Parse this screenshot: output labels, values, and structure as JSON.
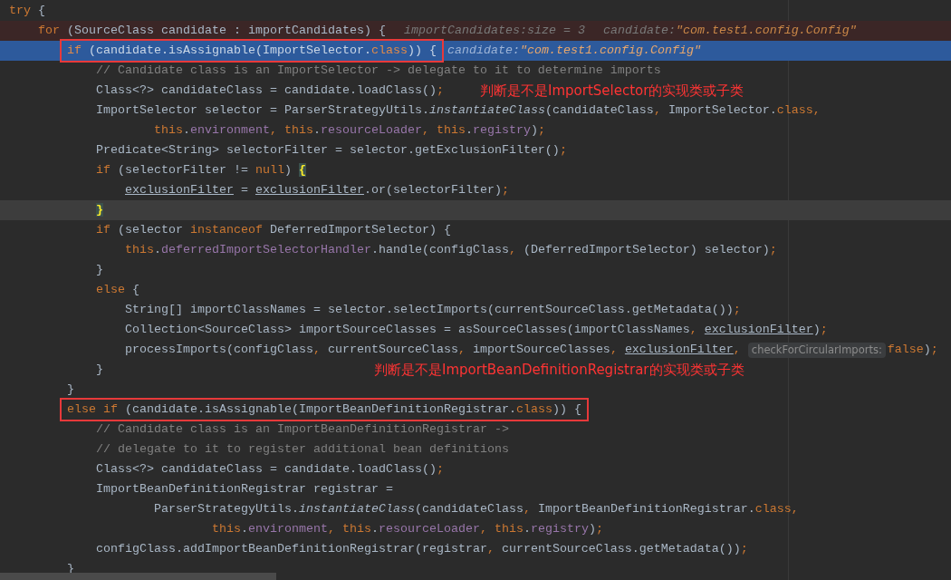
{
  "lines": [
    {
      "breakpoint": false,
      "execution": false,
      "caret": false,
      "boxed": false,
      "tokens": [
        {
          "kind": "kw",
          "text": "try"
        },
        {
          "kind": "p",
          "text": " {"
        }
      ]
    },
    {
      "breakpoint": true,
      "execution": false,
      "caret": false,
      "boxed": false,
      "tokens": [
        {
          "kind": "kw",
          "text": "    for"
        },
        {
          "kind": "p",
          "text": " (SourceClass candidate : importCandidates) {"
        }
      ],
      "debug": [
        {
          "name": "importCandidates:",
          "value": "size = 3",
          "kind": "plain"
        },
        {
          "name": "candidate:",
          "value": "\"com.test1.config.Config\"",
          "kind": "string"
        }
      ]
    },
    {
      "breakpoint": false,
      "execution": true,
      "caret": false,
      "boxed": true,
      "tokens": [
        {
          "kind": "kw",
          "text": "        if"
        },
        {
          "kind": "p",
          "text": " (candidate.isAssignable(ImportSelector."
        },
        {
          "kind": "kw",
          "text": "class"
        },
        {
          "kind": "p",
          "text": ")) {"
        }
      ],
      "debug": [
        {
          "name": "candidate:",
          "value": "\"com.test1.config.Config\"",
          "kind": "string"
        }
      ]
    },
    {
      "breakpoint": false,
      "execution": false,
      "caret": false,
      "boxed": false,
      "tokens": [
        {
          "kind": "cm",
          "text": "            // Candidate class is an ImportSelector -> delegate to it to determine imports"
        }
      ]
    },
    {
      "breakpoint": false,
      "execution": false,
      "caret": false,
      "boxed": false,
      "tokens": [
        {
          "kind": "p",
          "text": "            Class<?> candidateClass = candidate.loadClass()"
        },
        {
          "kind": "kw",
          "text": ";"
        }
      ],
      "note": "判断是不是ImportSelector的实现类或子类"
    },
    {
      "breakpoint": false,
      "execution": false,
      "caret": false,
      "boxed": false,
      "tokens": [
        {
          "kind": "p",
          "text": "            ImportSelector selector = ParserStrategyUtils."
        },
        {
          "kind": "it",
          "text": "instantiateClass"
        },
        {
          "kind": "p",
          "text": "(candidateClass"
        },
        {
          "kind": "kw",
          "text": ", "
        },
        {
          "kind": "p",
          "text": "ImportSelector."
        },
        {
          "kind": "kw",
          "text": "class,"
        }
      ]
    },
    {
      "breakpoint": false,
      "execution": false,
      "caret": false,
      "boxed": false,
      "tokens": [
        {
          "kind": "kw",
          "text": "                    this"
        },
        {
          "kind": "p",
          "text": "."
        },
        {
          "kind": "fd",
          "text": "environment"
        },
        {
          "kind": "kw",
          "text": ", this"
        },
        {
          "kind": "p",
          "text": "."
        },
        {
          "kind": "fd",
          "text": "resourceLoader"
        },
        {
          "kind": "kw",
          "text": ", this"
        },
        {
          "kind": "p",
          "text": "."
        },
        {
          "kind": "fd",
          "text": "registry"
        },
        {
          "kind": "p",
          "text": ")"
        },
        {
          "kind": "kw",
          "text": ";"
        }
      ]
    },
    {
      "breakpoint": false,
      "execution": false,
      "caret": false,
      "boxed": false,
      "tokens": [
        {
          "kind": "p",
          "text": "            Predicate<String> selectorFilter = selector.getExclusionFilter()"
        },
        {
          "kind": "kw",
          "text": ";"
        }
      ]
    },
    {
      "breakpoint": false,
      "execution": false,
      "caret": false,
      "boxed": false,
      "tokens": [
        {
          "kind": "kw",
          "text": "            if"
        },
        {
          "kind": "p",
          "text": " (selectorFilter != "
        },
        {
          "kind": "kw",
          "text": "null"
        },
        {
          "kind": "p",
          "text": ") "
        },
        {
          "kind": "mt",
          "text": "{"
        }
      ]
    },
    {
      "breakpoint": false,
      "execution": false,
      "caret": false,
      "boxed": false,
      "tokens": [
        {
          "kind": "ul",
          "text": "                exclusionFilter"
        },
        {
          "kind": "p",
          "text": " = "
        },
        {
          "kind": "ul",
          "text": "exclusionFilter"
        },
        {
          "kind": "p",
          "text": ".or(selectorFilter)"
        },
        {
          "kind": "kw",
          "text": ";"
        }
      ]
    },
    {
      "breakpoint": false,
      "execution": false,
      "caret": true,
      "boxed": false,
      "tokens": [
        {
          "kind": "mt",
          "text": "            }"
        }
      ]
    },
    {
      "breakpoint": false,
      "execution": false,
      "caret": false,
      "boxed": false,
      "tokens": [
        {
          "kind": "kw",
          "text": "            if"
        },
        {
          "kind": "p",
          "text": " (selector "
        },
        {
          "kind": "kw",
          "text": "instanceof"
        },
        {
          "kind": "p",
          "text": " DeferredImportSelector) {"
        }
      ]
    },
    {
      "breakpoint": false,
      "execution": false,
      "caret": false,
      "boxed": false,
      "tokens": [
        {
          "kind": "kw",
          "text": "                this"
        },
        {
          "kind": "p",
          "text": "."
        },
        {
          "kind": "fd",
          "text": "deferredImportSelectorHandler"
        },
        {
          "kind": "p",
          "text": ".handle(configClass"
        },
        {
          "kind": "kw",
          "text": ", "
        },
        {
          "kind": "p",
          "text": "(DeferredImportSelector) selector)"
        },
        {
          "kind": "kw",
          "text": ";"
        }
      ]
    },
    {
      "breakpoint": false,
      "execution": false,
      "caret": false,
      "boxed": false,
      "tokens": [
        {
          "kind": "p",
          "text": "            }"
        }
      ]
    },
    {
      "breakpoint": false,
      "execution": false,
      "caret": false,
      "boxed": false,
      "tokens": [
        {
          "kind": "kw",
          "text": "            else"
        },
        {
          "kind": "p",
          "text": " {"
        }
      ]
    },
    {
      "breakpoint": false,
      "execution": false,
      "caret": false,
      "boxed": false,
      "tokens": [
        {
          "kind": "p",
          "text": "                String[] importClassNames = selector.selectImports(currentSourceClass.getMetadata())"
        },
        {
          "kind": "kw",
          "text": ";"
        }
      ]
    },
    {
      "breakpoint": false,
      "execution": false,
      "caret": false,
      "boxed": false,
      "tokens": [
        {
          "kind": "p",
          "text": "                Collection<SourceClass> importSourceClasses = asSourceClasses(importClassNames"
        },
        {
          "kind": "kw",
          "text": ", "
        },
        {
          "kind": "ul",
          "text": "exclusionFilter"
        },
        {
          "kind": "p",
          "text": ")"
        },
        {
          "kind": "kw",
          "text": ";"
        }
      ]
    },
    {
      "breakpoint": false,
      "execution": false,
      "caret": false,
      "boxed": false,
      "tokens": [
        {
          "kind": "p",
          "text": "                processImports(configClass"
        },
        {
          "kind": "kw",
          "text": ", "
        },
        {
          "kind": "p",
          "text": "currentSourceClass"
        },
        {
          "kind": "kw",
          "text": ", "
        },
        {
          "kind": "p",
          "text": "importSourceClasses"
        },
        {
          "kind": "kw",
          "text": ", "
        },
        {
          "kind": "ul",
          "text": "exclusionFilter"
        },
        {
          "kind": "kw",
          "text": ","
        },
        {
          "kind": "hint",
          "text": "checkForCircularImports:"
        },
        {
          "kind": "kw",
          "text": "false"
        },
        {
          "kind": "p",
          "text": ")"
        },
        {
          "kind": "kw",
          "text": ";"
        }
      ]
    },
    {
      "breakpoint": false,
      "execution": false,
      "caret": false,
      "boxed": false,
      "tokens": [
        {
          "kind": "p",
          "text": "            }"
        }
      ],
      "note": "判断是不是ImportBeanDefinitionRegistrar的实现类或子类"
    },
    {
      "breakpoint": false,
      "execution": false,
      "caret": false,
      "boxed": false,
      "tokens": [
        {
          "kind": "p",
          "text": "        }"
        }
      ]
    },
    {
      "breakpoint": false,
      "execution": false,
      "caret": false,
      "boxed": true,
      "tokens": [
        {
          "kind": "kw",
          "text": "        else if"
        },
        {
          "kind": "p",
          "text": " (candidate.isAssignable(ImportBeanDefinitionRegistrar."
        },
        {
          "kind": "kw",
          "text": "class"
        },
        {
          "kind": "p",
          "text": ")) {"
        }
      ]
    },
    {
      "breakpoint": false,
      "execution": false,
      "caret": false,
      "boxed": false,
      "tokens": [
        {
          "kind": "cm",
          "text": "            // Candidate class is an ImportBeanDefinitionRegistrar ->"
        }
      ]
    },
    {
      "breakpoint": false,
      "execution": false,
      "caret": false,
      "boxed": false,
      "tokens": [
        {
          "kind": "cm",
          "text": "            // delegate to it to register additional bean definitions"
        }
      ]
    },
    {
      "breakpoint": false,
      "execution": false,
      "caret": false,
      "boxed": false,
      "tokens": [
        {
          "kind": "p",
          "text": "            Class<?> candidateClass = candidate.loadClass()"
        },
        {
          "kind": "kw",
          "text": ";"
        }
      ]
    },
    {
      "breakpoint": false,
      "execution": false,
      "caret": false,
      "boxed": false,
      "tokens": [
        {
          "kind": "p",
          "text": "            ImportBeanDefinitionRegistrar registrar ="
        }
      ]
    },
    {
      "breakpoint": false,
      "execution": false,
      "caret": false,
      "boxed": false,
      "tokens": [
        {
          "kind": "p",
          "text": "                    ParserStrategyUtils."
        },
        {
          "kind": "it",
          "text": "instantiateClass"
        },
        {
          "kind": "p",
          "text": "(candidateClass"
        },
        {
          "kind": "kw",
          "text": ", "
        },
        {
          "kind": "p",
          "text": "ImportBeanDefinitionRegistrar."
        },
        {
          "kind": "kw",
          "text": "class,"
        }
      ]
    },
    {
      "breakpoint": false,
      "execution": false,
      "caret": false,
      "boxed": false,
      "tokens": [
        {
          "kind": "kw",
          "text": "                            this"
        },
        {
          "kind": "p",
          "text": "."
        },
        {
          "kind": "fd",
          "text": "environment"
        },
        {
          "kind": "kw",
          "text": ", this"
        },
        {
          "kind": "p",
          "text": "."
        },
        {
          "kind": "fd",
          "text": "resourceLoader"
        },
        {
          "kind": "kw",
          "text": ", this"
        },
        {
          "kind": "p",
          "text": "."
        },
        {
          "kind": "fd",
          "text": "registry"
        },
        {
          "kind": "p",
          "text": ")"
        },
        {
          "kind": "kw",
          "text": ";"
        }
      ]
    },
    {
      "breakpoint": false,
      "execution": false,
      "caret": false,
      "boxed": false,
      "tokens": [
        {
          "kind": "p",
          "text": "            configClass.addImportBeanDefinitionRegistrar(registrar"
        },
        {
          "kind": "kw",
          "text": ", "
        },
        {
          "kind": "p",
          "text": "currentSourceClass.getMetadata())"
        },
        {
          "kind": "kw",
          "text": ";"
        }
      ]
    },
    {
      "breakpoint": false,
      "execution": false,
      "caret": false,
      "boxed": false,
      "tokens": [
        {
          "kind": "p",
          "text": "        }"
        }
      ]
    }
  ]
}
